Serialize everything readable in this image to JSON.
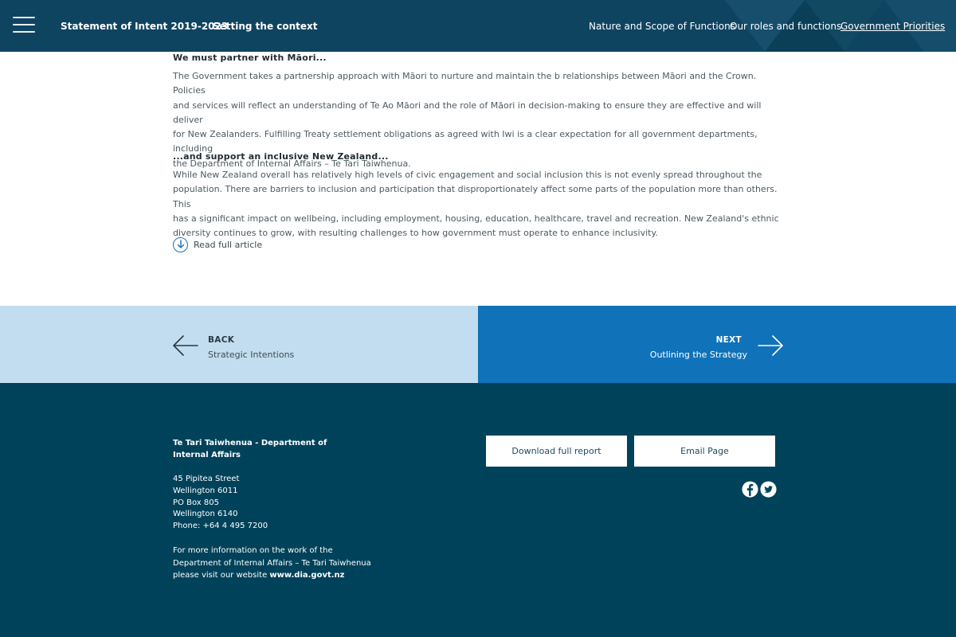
{
  "header": {
    "breadcrumb_1": "Statement of Intent 2019-2023",
    "breadcrumb_2": "Setting the context",
    "nav": [
      {
        "label": "Nature and Scope of Functions"
      },
      {
        "label": "Our roles and functions"
      },
      {
        "label": "Government Priorities"
      }
    ],
    "menu_icon": "hamburger-icon"
  },
  "main": {
    "section_1": {
      "heading": "We must partner with Māori...",
      "lines": [
        "The Government takes a partnership approach with Māori to nurture and maintain the b relationships between Māori and the Crown. Policies",
        "and services will reflect an understanding of Te Ao Māori and the role of Māori in decision-making to ensure they are effective and will deliver",
        "for New Zealanders. Fulfilling Treaty settlement obligations as agreed with Iwi is a clear expectation for all government departments, including",
        "the Department of Internal Affairs – Te Tari Taiwhenua."
      ]
    },
    "section_2": {
      "heading": "...and support an inclusive New Zealand...",
      "lines": [
        "While New Zealand overall has relatively high levels of civic engagement and social inclusion this is not evenly spread throughout the",
        "population. There are barriers to inclusion and participation that disproportionately affect some parts of the population more than others. This",
        "has a significant impact on wellbeing, including employment, housing, education, healthcare, travel and recreation. New Zealand's ethnic",
        "diversity continues to grow, with resulting challenges to how government must operate to enhance inclusivity."
      ]
    },
    "read_more": {
      "label": "Read full article",
      "icon": "arrow-down-circle-icon"
    }
  },
  "pager": {
    "back": {
      "title": "BACK",
      "subtitle": "Strategic Intentions",
      "icon": "arrow-left-icon"
    },
    "next": {
      "title": "NEXT",
      "subtitle": "Outlining the Strategy",
      "icon": "arrow-right-icon"
    }
  },
  "footer": {
    "org_name": "Te Tari Taiwhenua - Department of Internal Affairs",
    "address": [
      "45 Pipitea Street",
      "Wellington 6011",
      "PO Box 805",
      "Wellington 6140",
      "Phone: +64 4 495 7200"
    ],
    "more_info_lines": [
      "For more information on the work of the",
      "Department of Internal Affairs – Te Tari Taiwhenua",
      "please visit our website "
    ],
    "website": "www.dia.govt.nz",
    "buttons": {
      "download": "Download full report",
      "email": "Email Page"
    },
    "social": [
      "facebook-icon",
      "twitter-icon"
    ]
  },
  "colors": {
    "header_bg": "#0f4461",
    "back_bg": "#c2ddef",
    "next_bg": "#1072b9",
    "footer_bg": "#00425a",
    "accent": "#1b73b3"
  }
}
